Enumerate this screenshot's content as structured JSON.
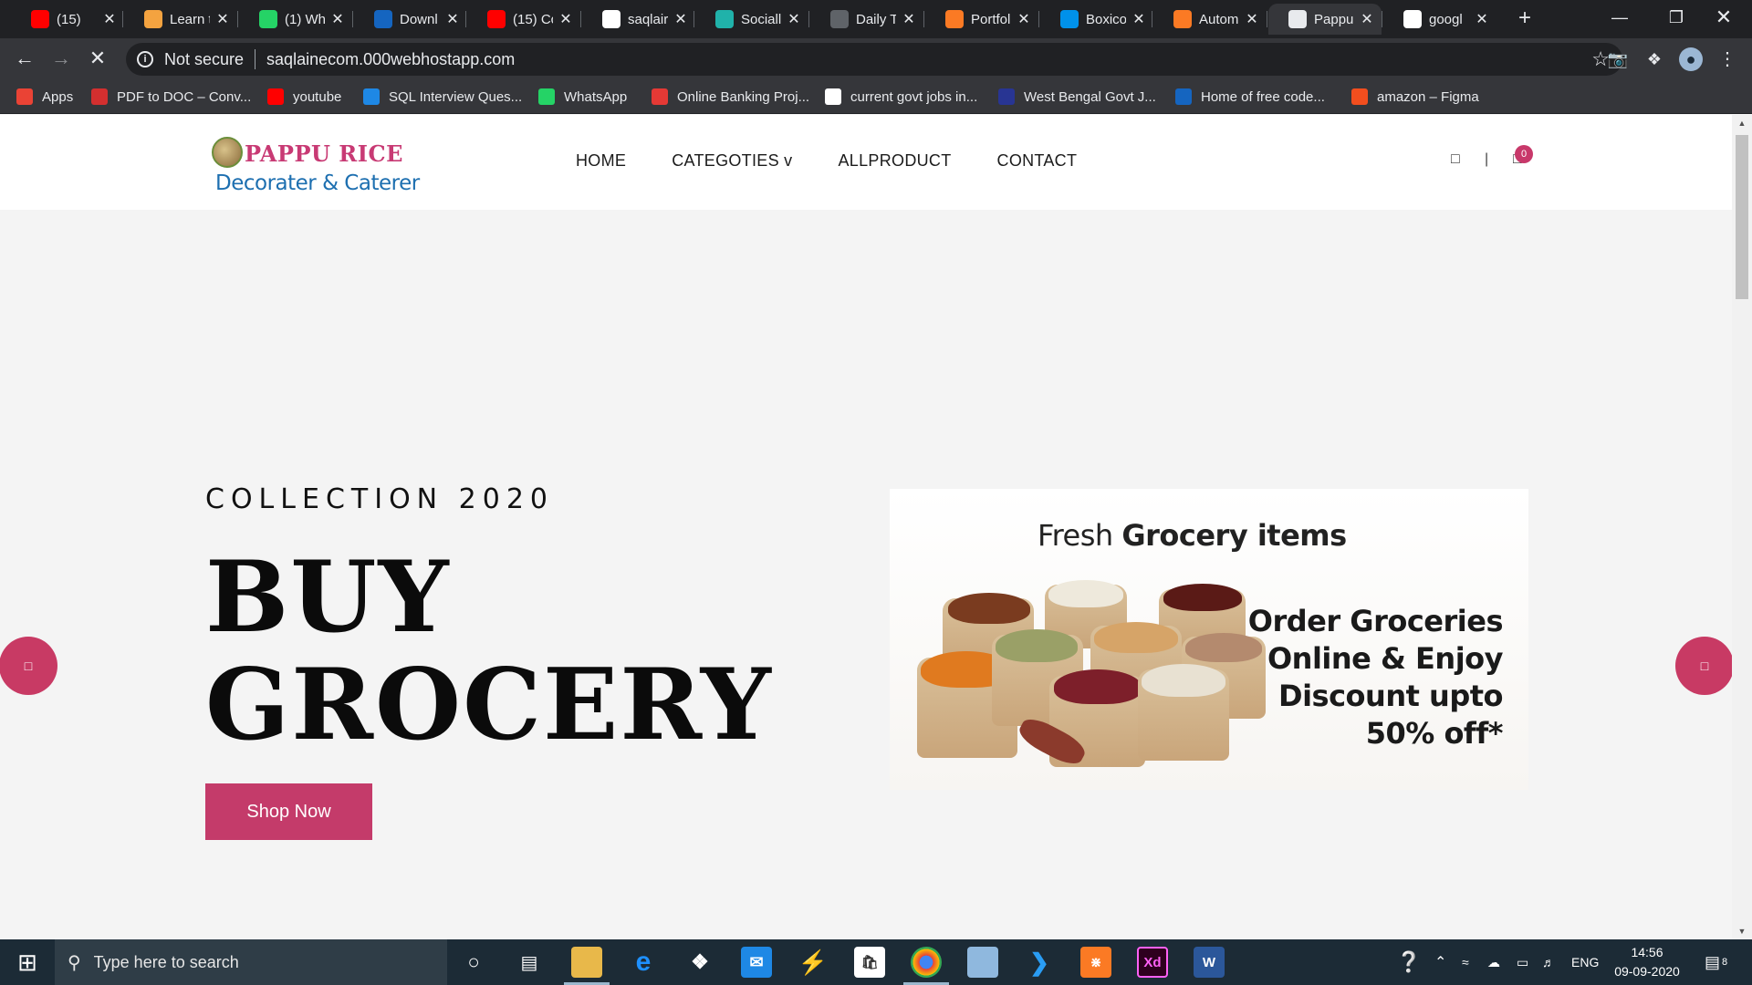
{
  "browser": {
    "tabs": [
      {
        "title": "(15)",
        "icon": "youtube-icon",
        "color": "#ff0000"
      },
      {
        "title": "Learn t",
        "icon": "learn-icon",
        "color": "#f4a340"
      },
      {
        "title": "(1) Wh",
        "icon": "whatsapp-icon",
        "color": "#25d366"
      },
      {
        "title": "Downl",
        "icon": "tm-icon",
        "color": "#1565c0"
      },
      {
        "title": "(15) Cc",
        "icon": "youtube-icon",
        "color": "#ff0000"
      },
      {
        "title": "saqlair",
        "icon": "github-icon",
        "color": "#ffffff"
      },
      {
        "title": "Sociall",
        "icon": "social-icon",
        "color": "#20b2aa"
      },
      {
        "title": "Daily T",
        "icon": "globe-icon",
        "color": "#5f6368"
      },
      {
        "title": "Portfol",
        "icon": "xampp-icon",
        "color": "#fb7a24"
      },
      {
        "title": "Boxico",
        "icon": "boxicons-icon",
        "color": "#0091ea"
      },
      {
        "title": "Autom",
        "icon": "xampp-icon",
        "color": "#fb7a24"
      },
      {
        "title": "Pappu",
        "icon": "loading-icon",
        "color": "#e8eaed"
      },
      {
        "title": "googl",
        "icon": "google-icon",
        "color": "#ffffff"
      }
    ],
    "address": {
      "security": "Not secure",
      "url": "saqlainecom.000webhostapp.com"
    },
    "bookmarks": [
      {
        "label": "Apps",
        "icon": "apps-grid-icon",
        "color": "#ea4335"
      },
      {
        "label": "PDF to DOC – Conv...",
        "icon": "pdf-icon",
        "color": "#d32f2f"
      },
      {
        "label": "youtube",
        "icon": "youtube-icon",
        "color": "#ff0000"
      },
      {
        "label": "SQL Interview Ques...",
        "icon": "ib-icon",
        "color": "#1e88e5"
      },
      {
        "label": "WhatsApp",
        "icon": "whatsapp-icon",
        "color": "#25d366"
      },
      {
        "label": "Online Banking Proj...",
        "icon": "vimeo-icon",
        "color": "#e53935"
      },
      {
        "label": "current govt jobs in...",
        "icon": "google-icon",
        "color": "#ffffff"
      },
      {
        "label": "West Bengal Govt J...",
        "icon": "folder-icon",
        "color": "#283593"
      },
      {
        "label": "Home of free code...",
        "icon": "code-icon",
        "color": "#1565c0"
      },
      {
        "label": "amazon – Figma",
        "icon": "figma-icon",
        "color": "#f24e1e"
      }
    ]
  },
  "site": {
    "logo": {
      "title": "PAPPU RICE",
      "subtitle": "Decorater & Caterer"
    },
    "nav": [
      "HOME",
      "CATEGOTIES v",
      "ALLPRODUCT",
      "CONTACT"
    ],
    "cart_count": "0",
    "hero": {
      "eyebrow": "COLLECTION 2020",
      "title_line1": "BUY",
      "title_line2": "GROCERY",
      "cta": "Shop Now"
    },
    "promo": {
      "head_light": "Fresh ",
      "head_bold": "Grocery items",
      "offer": [
        "Order Groceries",
        "Online & Enjoy",
        "Discount upto",
        "50% off*"
      ]
    },
    "accent": "#c43b6a"
  },
  "taskbar": {
    "search_placeholder": "Type here to search",
    "lang": "ENG",
    "time": "14:56",
    "date": "09-09-2020",
    "notifications": "8"
  }
}
